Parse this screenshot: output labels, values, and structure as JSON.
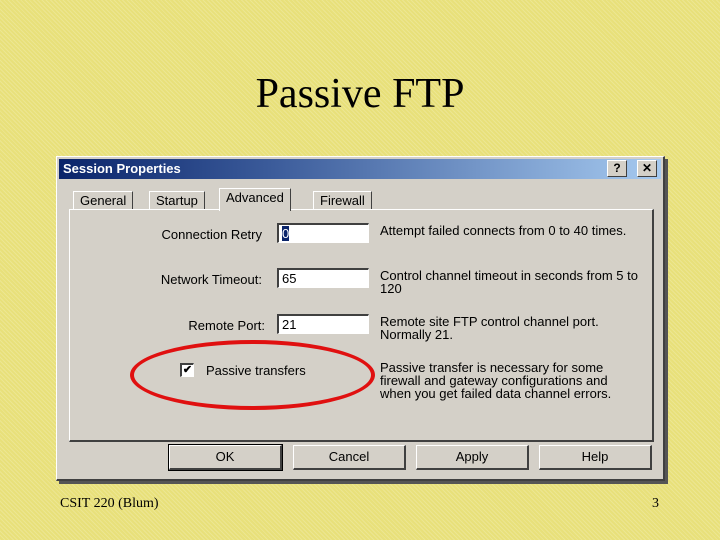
{
  "slide": {
    "title": "Passive FTP",
    "footer_left": "CSIT 220 (Blum)",
    "page_number": "3"
  },
  "dialog": {
    "title": "Session Properties",
    "help_button": "?",
    "close_button": "✕",
    "tabs": [
      {
        "label": "General",
        "active": false
      },
      {
        "label": "Startup",
        "active": false
      },
      {
        "label": "Advanced",
        "active": true
      },
      {
        "label": "Firewall",
        "active": false
      }
    ],
    "fields": [
      {
        "label": "Connection Retry",
        "value": "0",
        "description": "Attempt failed connects from 0 to 40 times."
      },
      {
        "label": "Network Timeout:",
        "value": "65",
        "description": "Control channel timeout in seconds from 5 to 120"
      },
      {
        "label": "Remote Port:",
        "value": "21",
        "description": "Remote site FTP control channel port. Normally 21."
      }
    ],
    "passive": {
      "label": "Passive transfers",
      "checked": true,
      "check_glyph": "✔",
      "description": "Passive transfer is necessary for some firewall and gateway configurations and when you get failed data channel errors."
    },
    "buttons": {
      "ok": "OK",
      "cancel": "Cancel",
      "apply": "Apply",
      "help": "Help"
    }
  },
  "annotation": {
    "color": "#e01010",
    "highlights": "Passive transfers"
  }
}
